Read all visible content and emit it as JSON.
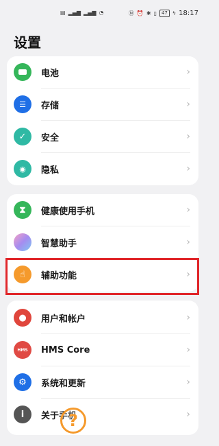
{
  "status_bar": {
    "left_icons": [
      "sim-signal-icon",
      "signal-4g-icon",
      "signal-5g-icon",
      "wifi-icon"
    ],
    "right_icons": [
      "nfc-icon",
      "alarm-icon",
      "bluetooth-icon",
      "vibrate-icon"
    ],
    "battery": "47",
    "time": "18:17"
  },
  "page": {
    "title": "设置"
  },
  "groups": [
    {
      "items": [
        {
          "label": "电池",
          "icon": "battery-icon",
          "color": "#35b65a"
        },
        {
          "label": "存储",
          "icon": "storage-icon",
          "color": "#1f6fe6"
        },
        {
          "label": "安全",
          "icon": "shield-icon",
          "color": "#2fb9a4"
        },
        {
          "label": "隐私",
          "icon": "privacy-icon",
          "color": "#2fb9a4"
        }
      ]
    },
    {
      "items": [
        {
          "label": "健康使用手机",
          "icon": "hourglass-icon",
          "color": "#35b65a"
        },
        {
          "label": "智慧助手",
          "icon": "assistant-icon",
          "color": "#c27be8"
        },
        {
          "label": "辅助功能",
          "icon": "accessibility-hand-icon",
          "color": "#f59a2c"
        }
      ]
    },
    {
      "items": [
        {
          "label": "用户和帐户",
          "icon": "user-icon",
          "color": "#e0463c"
        },
        {
          "label": "HMS Core",
          "icon": "hms-icon",
          "color": "#e04a44"
        },
        {
          "label": "系统和更新",
          "icon": "gear-icon",
          "color": "#1f6fe6"
        },
        {
          "label": "关于手机",
          "icon": "info-icon",
          "color": "#555555"
        }
      ]
    }
  ],
  "icons_glyphs": {
    "hms_text": "HMS",
    "question": "?"
  },
  "annotations": {
    "highlight_color": "#e0262a",
    "question_color": "#f59a2c"
  }
}
